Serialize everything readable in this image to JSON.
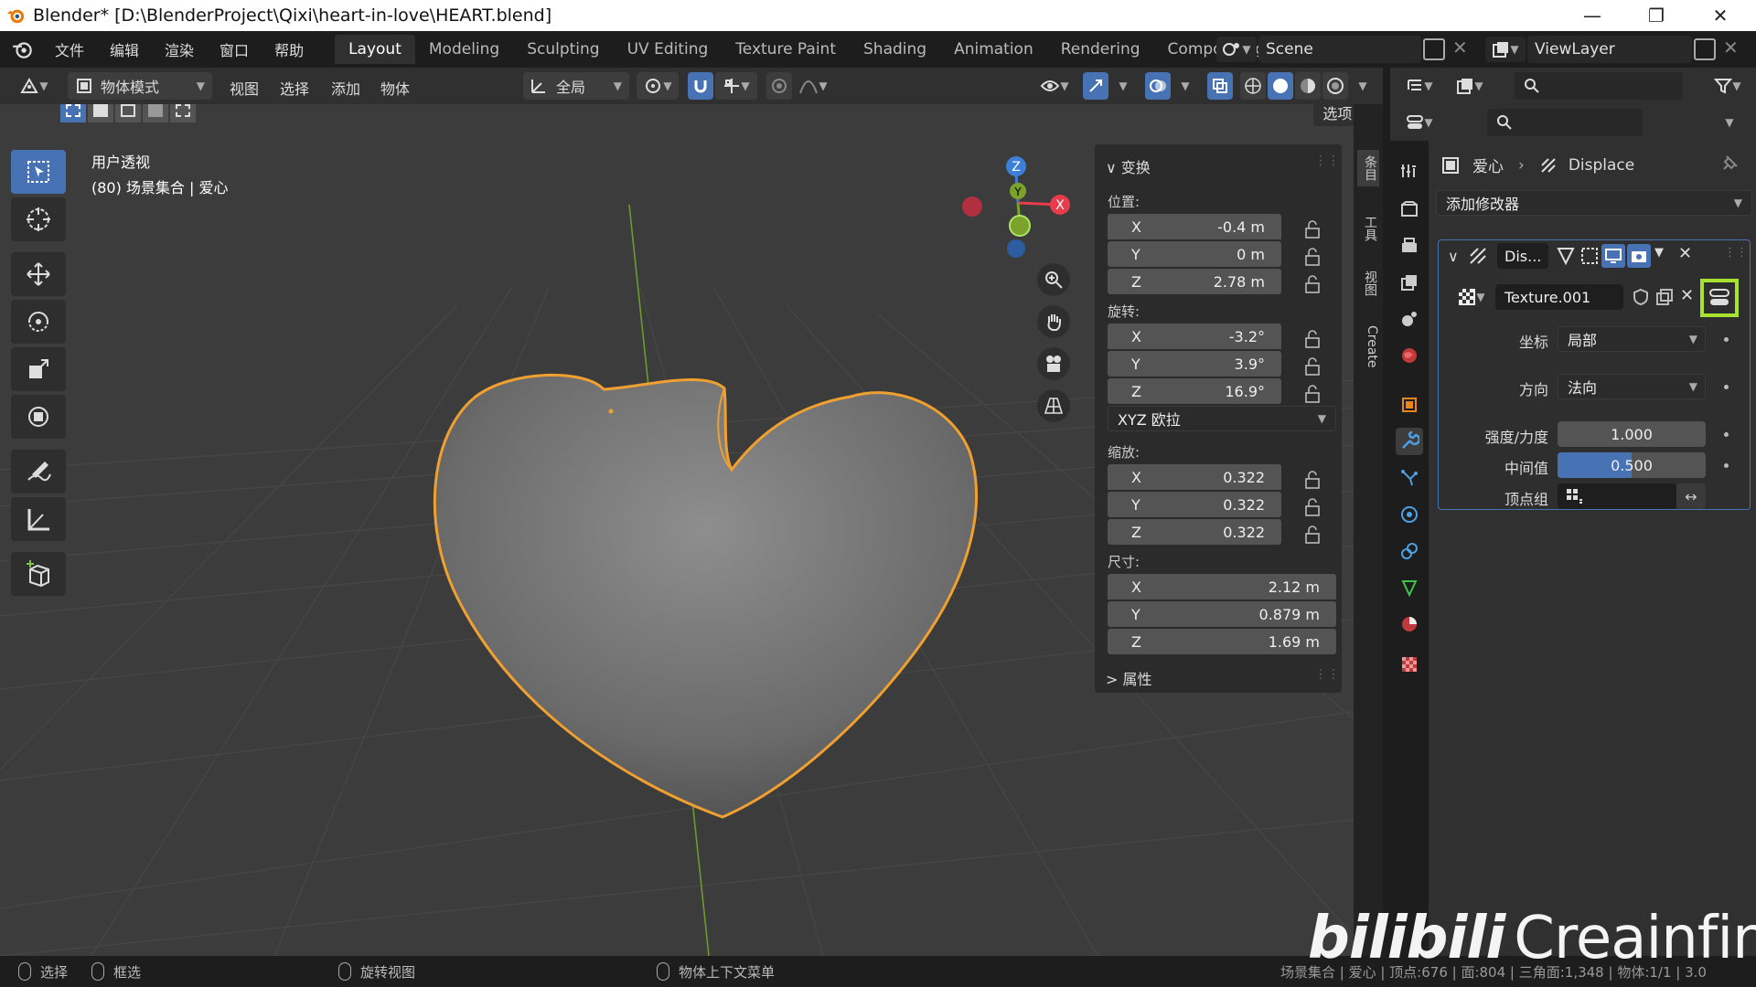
{
  "window": {
    "title": "Blender* [D:\\BlenderProject\\Qixi\\heart-in-love\\HEART.blend]"
  },
  "menus": [
    "文件",
    "编辑",
    "渲染",
    "窗口",
    "帮助"
  ],
  "workspaces": [
    "Layout",
    "Modeling",
    "Sculpting",
    "UV Editing",
    "Texture Paint",
    "Shading",
    "Animation",
    "Rendering",
    "Compositing"
  ],
  "active_workspace": "Layout",
  "scene": "Scene",
  "view_layer": "ViewLayer",
  "viewport_header": {
    "mode": "物体模式",
    "menus": [
      "视图",
      "选择",
      "添加",
      "物体"
    ],
    "orientation": "全局",
    "options": "选项"
  },
  "viewport_info": {
    "line1": "用户透视",
    "line2": "(80) 场景集合 | 爱心"
  },
  "gizmo": {
    "x": "X",
    "y": "Y",
    "z": "Z"
  },
  "npanel": {
    "section_transform": "变换",
    "location_label": "位置:",
    "location": [
      {
        "axis": "X",
        "value": "-0.4 m"
      },
      {
        "axis": "Y",
        "value": "0 m"
      },
      {
        "axis": "Z",
        "value": "2.78 m"
      }
    ],
    "rotation_label": "旋转:",
    "rotation": [
      {
        "axis": "X",
        "value": "-3.2°"
      },
      {
        "axis": "Y",
        "value": "3.9°"
      },
      {
        "axis": "Z",
        "value": "16.9°"
      }
    ],
    "rotation_mode": "XYZ 欧拉",
    "scale_label": "缩放:",
    "scale": [
      {
        "axis": "X",
        "value": "0.322"
      },
      {
        "axis": "Y",
        "value": "0.322"
      },
      {
        "axis": "Z",
        "value": "0.322"
      }
    ],
    "dimensions_label": "尺寸:",
    "dimensions": [
      {
        "axis": "X",
        "value": "2.12 m"
      },
      {
        "axis": "Y",
        "value": "0.879 m"
      },
      {
        "axis": "Z",
        "value": "1.69 m"
      }
    ],
    "section_properties": "属性",
    "tabs": [
      "条目",
      "工具",
      "视图",
      "Create"
    ]
  },
  "properties": {
    "breadcrumb_object": "爱心",
    "breadcrumb_modifier": "Displace",
    "add_modifier": "添加修改器",
    "modifier_name": "Dis...",
    "texture": "Texture.001",
    "coords_label": "坐标",
    "coords_value": "局部",
    "direction_label": "方向",
    "direction_value": "法向",
    "strength_label": "强度/力度",
    "strength_value": "1.000",
    "midlevel_label": "中间值",
    "midlevel_value": "0.500",
    "midlevel_fraction": 0.5,
    "vgroup_label": "顶点组"
  },
  "statusbar": {
    "select": "选择",
    "box_select": "框选",
    "rotate_view": "旋转视图",
    "context_menu": "物体上下文菜单",
    "stats": "场景集合 | 爱心 | 顶点:676 | 面:804 | 三角面:1,348 | 物体:1/1 | 3.0"
  },
  "watermark": "Creainfinity",
  "colors": {
    "accent": "#4772b3",
    "selection_outline": "#f0a030",
    "highlight_box": "#a6e22e",
    "gizmo_x": "#e83b4b",
    "gizmo_y": "#7ba32b",
    "gizmo_z": "#3d7fd8"
  }
}
